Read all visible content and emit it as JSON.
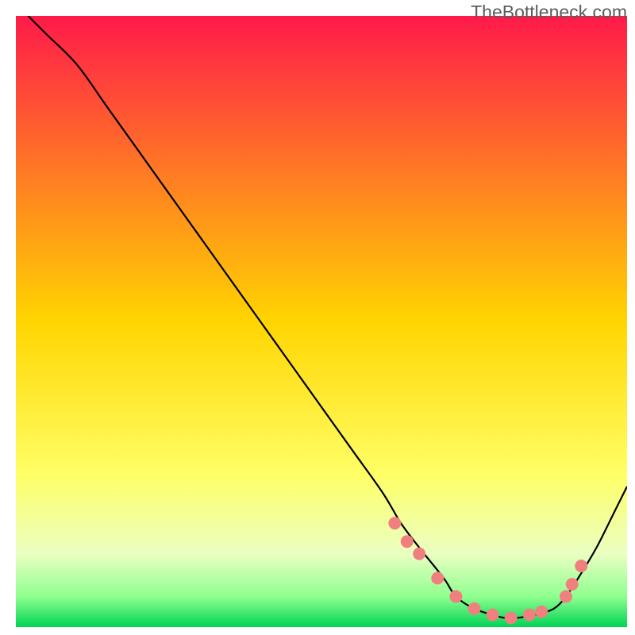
{
  "watermark": "TheBottleneck.com",
  "chart_data": {
    "type": "line",
    "title": "",
    "xlabel": "",
    "ylabel": "",
    "xlim": [
      0,
      100
    ],
    "ylim": [
      0,
      100
    ],
    "grid": false,
    "series": [
      {
        "name": "curve",
        "x": [
          2,
          5,
          10,
          15,
          20,
          25,
          30,
          35,
          40,
          45,
          50,
          55,
          60,
          63,
          66,
          70,
          72,
          75,
          78,
          80,
          82,
          85,
          88,
          90,
          92,
          95,
          98,
          100
        ],
        "y": [
          100,
          97,
          92,
          85,
          78,
          71,
          64,
          57,
          50,
          43,
          36,
          29,
          22,
          17,
          13,
          8,
          5,
          3,
          2,
          1.5,
          1.5,
          2,
          3,
          5,
          8,
          13,
          19,
          23
        ]
      }
    ],
    "markers": {
      "name": "highlight-points",
      "color": "#f08080",
      "x": [
        62,
        64,
        66,
        69,
        72,
        75,
        78,
        81,
        84,
        86,
        90,
        91,
        92.5
      ],
      "y": [
        17,
        14,
        12,
        8,
        5,
        3,
        2,
        1.5,
        2,
        2.5,
        5,
        7,
        10
      ]
    },
    "background": {
      "type": "vertical-gradient",
      "stops": [
        {
          "pos": 0,
          "color": "#ff1a4a"
        },
        {
          "pos": 50,
          "color": "#ffd500"
        },
        {
          "pos": 75,
          "color": "#ffff66"
        },
        {
          "pos": 88,
          "color": "#eaffc2"
        },
        {
          "pos": 95,
          "color": "#8fff8f"
        },
        {
          "pos": 100,
          "color": "#00d455"
        }
      ]
    }
  }
}
